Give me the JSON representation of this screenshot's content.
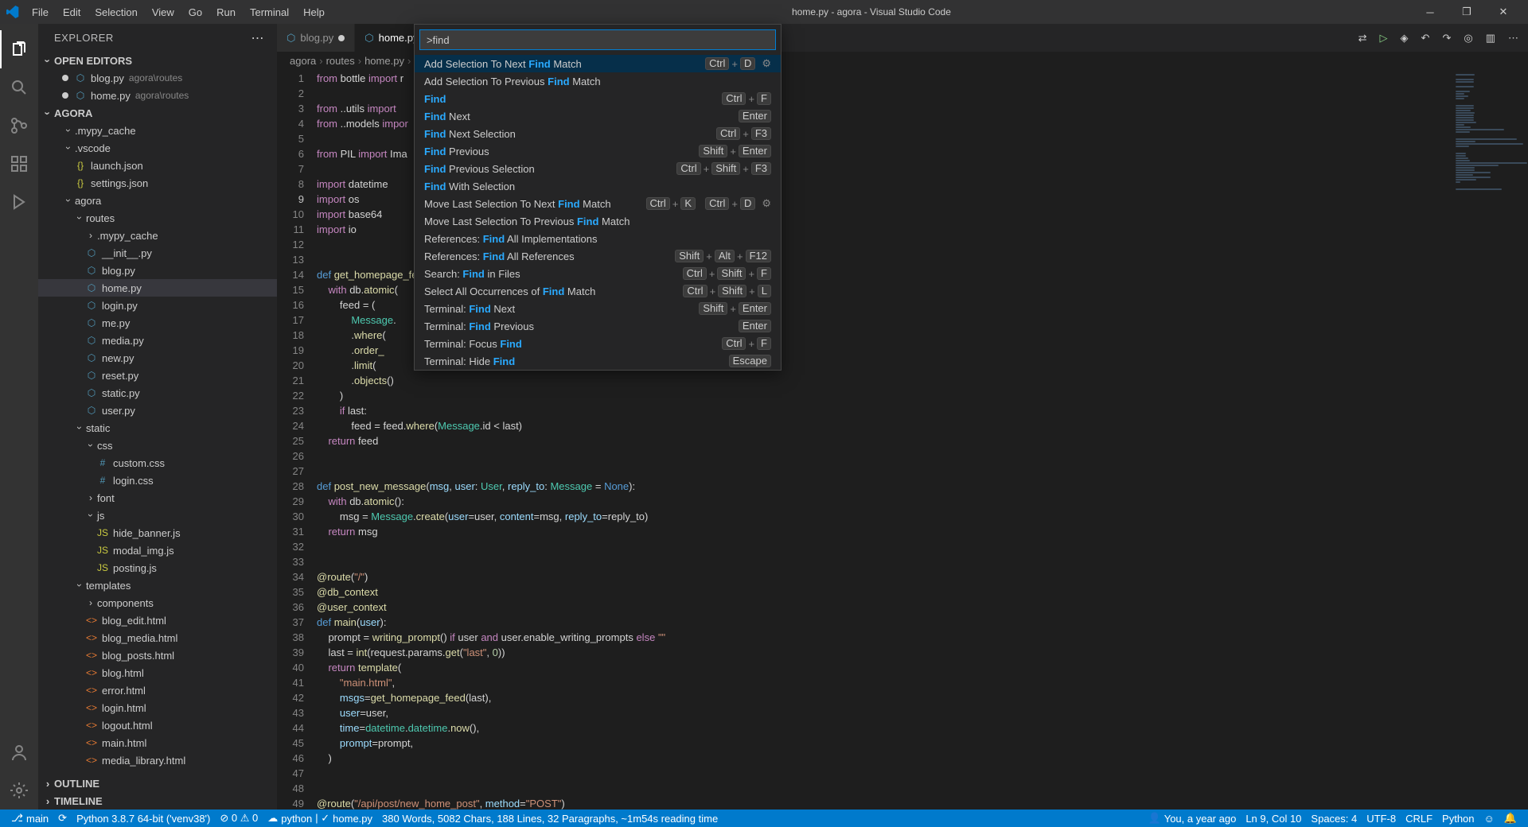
{
  "window_title": "home.py - agora - Visual Studio Code",
  "menu": [
    "File",
    "Edit",
    "Selection",
    "View",
    "Go",
    "Run",
    "Terminal",
    "Help"
  ],
  "explorer_title": "EXPLORER",
  "sections": {
    "open_editors": "OPEN EDITORS",
    "workspace": "AGORA",
    "outline": "OUTLINE",
    "timeline": "TIMELINE"
  },
  "open_editors": [
    {
      "name": "blog.py",
      "desc": "agora\\routes"
    },
    {
      "name": "home.py",
      "desc": "agora\\routes"
    }
  ],
  "tabs": [
    {
      "name": "blog.py",
      "active": false,
      "dirty": true
    },
    {
      "name": "home.py",
      "active": true,
      "dirty": true
    }
  ],
  "breadcrumbs": [
    "agora",
    "routes",
    "home.py",
    "..."
  ],
  "tree": [
    {
      "d": 1,
      "t": "folder",
      "open": true,
      "name": ".mypy_cache"
    },
    {
      "d": 1,
      "t": "folder",
      "open": true,
      "name": ".vscode"
    },
    {
      "d": 2,
      "t": "file",
      "ic": "json",
      "name": "launch.json"
    },
    {
      "d": 2,
      "t": "file",
      "ic": "json",
      "name": "settings.json"
    },
    {
      "d": 1,
      "t": "folder",
      "open": true,
      "name": "agora"
    },
    {
      "d": 2,
      "t": "folder",
      "open": true,
      "name": "routes"
    },
    {
      "d": 3,
      "t": "folder",
      "open": false,
      "name": ".mypy_cache"
    },
    {
      "d": 3,
      "t": "file",
      "ic": "py",
      "name": "__init__.py"
    },
    {
      "d": 3,
      "t": "file",
      "ic": "py",
      "name": "blog.py"
    },
    {
      "d": 3,
      "t": "file",
      "ic": "py",
      "name": "home.py",
      "sel": true
    },
    {
      "d": 3,
      "t": "file",
      "ic": "py",
      "name": "login.py"
    },
    {
      "d": 3,
      "t": "file",
      "ic": "py",
      "name": "me.py"
    },
    {
      "d": 3,
      "t": "file",
      "ic": "py",
      "name": "media.py"
    },
    {
      "d": 3,
      "t": "file",
      "ic": "py",
      "name": "new.py"
    },
    {
      "d": 3,
      "t": "file",
      "ic": "py",
      "name": "reset.py"
    },
    {
      "d": 3,
      "t": "file",
      "ic": "py",
      "name": "static.py"
    },
    {
      "d": 3,
      "t": "file",
      "ic": "py",
      "name": "user.py"
    },
    {
      "d": 2,
      "t": "folder",
      "open": true,
      "name": "static"
    },
    {
      "d": 3,
      "t": "folder",
      "open": true,
      "name": "css"
    },
    {
      "d": 4,
      "t": "file",
      "ic": "css",
      "name": "custom.css"
    },
    {
      "d": 4,
      "t": "file",
      "ic": "css",
      "name": "login.css"
    },
    {
      "d": 3,
      "t": "folder",
      "open": false,
      "name": "font"
    },
    {
      "d": 3,
      "t": "folder",
      "open": true,
      "name": "js"
    },
    {
      "d": 4,
      "t": "file",
      "ic": "js",
      "name": "hide_banner.js"
    },
    {
      "d": 4,
      "t": "file",
      "ic": "js",
      "name": "modal_img.js"
    },
    {
      "d": 4,
      "t": "file",
      "ic": "js",
      "name": "posting.js"
    },
    {
      "d": 2,
      "t": "folder",
      "open": true,
      "name": "templates"
    },
    {
      "d": 3,
      "t": "folder",
      "open": false,
      "name": "components"
    },
    {
      "d": 3,
      "t": "file",
      "ic": "html",
      "name": "blog_edit.html"
    },
    {
      "d": 3,
      "t": "file",
      "ic": "html",
      "name": "blog_media.html"
    },
    {
      "d": 3,
      "t": "file",
      "ic": "html",
      "name": "blog_posts.html"
    },
    {
      "d": 3,
      "t": "file",
      "ic": "html",
      "name": "blog.html"
    },
    {
      "d": 3,
      "t": "file",
      "ic": "html",
      "name": "error.html"
    },
    {
      "d": 3,
      "t": "file",
      "ic": "html",
      "name": "login.html"
    },
    {
      "d": 3,
      "t": "file",
      "ic": "html",
      "name": "logout.html"
    },
    {
      "d": 3,
      "t": "file",
      "ic": "html",
      "name": "main.html"
    },
    {
      "d": 3,
      "t": "file",
      "ic": "html",
      "name": "media_library.html"
    }
  ],
  "palette_input": ">find",
  "palette": [
    {
      "pre": "Add Selection To Next ",
      "hl": "Find",
      "post": " Match",
      "keys": [
        "Ctrl",
        "+",
        "D"
      ],
      "gear": true,
      "sel": true
    },
    {
      "pre": "Add Selection To Previous ",
      "hl": "Find",
      "post": " Match"
    },
    {
      "pre": "",
      "hl": "Find",
      "post": "",
      "keys": [
        "Ctrl",
        "+",
        "F"
      ]
    },
    {
      "pre": "",
      "hl": "Find",
      "post": " Next",
      "keys": [
        "Enter"
      ]
    },
    {
      "pre": "",
      "hl": "Find",
      "post": " Next Selection",
      "keys": [
        "Ctrl",
        "+",
        "F3"
      ]
    },
    {
      "pre": "",
      "hl": "Find",
      "post": " Previous",
      "keys": [
        "Shift",
        "+",
        "Enter"
      ]
    },
    {
      "pre": "",
      "hl": "Find",
      "post": " Previous Selection",
      "keys": [
        "Ctrl",
        "+",
        "Shift",
        "+",
        "F3"
      ]
    },
    {
      "pre": "",
      "hl": "Find",
      "post": " With Selection"
    },
    {
      "pre": "Move Last Selection To Next ",
      "hl": "Find",
      "post": " Match",
      "keys": [
        "Ctrl",
        "+",
        "K",
        "",
        "Ctrl",
        "+",
        "D"
      ],
      "gear": true
    },
    {
      "pre": "Move Last Selection To Previous ",
      "hl": "Find",
      "post": " Match"
    },
    {
      "pre": "References: ",
      "hl": "Find",
      "post": " All Implementations"
    },
    {
      "pre": "References: ",
      "hl": "Find",
      "post": " All References",
      "keys": [
        "Shift",
        "+",
        "Alt",
        "+",
        "F12"
      ]
    },
    {
      "pre": "Search: ",
      "hl": "Find",
      "post": " in Files",
      "keys": [
        "Ctrl",
        "+",
        "Shift",
        "+",
        "F"
      ]
    },
    {
      "pre": "Select All Occurrences of ",
      "hl": "Find",
      "post": " Match",
      "keys": [
        "Ctrl",
        "+",
        "Shift",
        "+",
        "L"
      ]
    },
    {
      "pre": "Terminal: ",
      "hl": "Find",
      "post": " Next",
      "keys": [
        "Shift",
        "+",
        "Enter"
      ]
    },
    {
      "pre": "Terminal: ",
      "hl": "Find",
      "post": " Previous",
      "keys": [
        "Enter"
      ]
    },
    {
      "pre": "Terminal: Focus ",
      "hl": "Find",
      "post": "",
      "keys": [
        "Ctrl",
        "+",
        "F"
      ]
    },
    {
      "pre": "Terminal: Hide ",
      "hl": "Find",
      "post": "",
      "keys": [
        "Escape"
      ]
    }
  ],
  "code": [
    {
      "n": 1,
      "h": "<span class='kw'>from</span> bottle <span class='kw'>import</span> r"
    },
    {
      "n": 2,
      "h": ""
    },
    {
      "n": 3,
      "h": "<span class='kw'>from</span> ..utils <span class='kw'>import</span>"
    },
    {
      "n": 4,
      "h": "<span class='kw'>from</span> ..models <span class='kw'>impor</span>"
    },
    {
      "n": 5,
      "h": ""
    },
    {
      "n": 6,
      "h": "<span class='kw'>from</span> PIL <span class='kw'>import</span> Ima"
    },
    {
      "n": 7,
      "h": ""
    },
    {
      "n": 8,
      "h": "<span class='kw'>import</span> datetime"
    },
    {
      "n": 9,
      "h": "<span class='kw'>import</span> os",
      "cur": true
    },
    {
      "n": 10,
      "h": "<span class='kw'>import</span> base64"
    },
    {
      "n": 11,
      "h": "<span class='kw'>import</span> io"
    },
    {
      "n": 12,
      "h": ""
    },
    {
      "n": 13,
      "h": ""
    },
    {
      "n": 14,
      "h": "<span class='kw2'>def</span> <span class='fn'>get_homepage_fe</span>"
    },
    {
      "n": 15,
      "h": "    <span class='kw'>with</span> db.<span class='fn'>atomic</span>("
    },
    {
      "n": 16,
      "h": "        feed <span class='op'>=</span> ("
    },
    {
      "n": 17,
      "h": "            <span class='cls'>Message</span>."
    },
    {
      "n": 18,
      "h": "            .<span class='fn'>where</span>("
    },
    {
      "n": 19,
      "h": "            .<span class='fn'>order_</span>"
    },
    {
      "n": 20,
      "h": "            .<span class='fn'>limit</span>("
    },
    {
      "n": 21,
      "h": "            .<span class='fn'>objects</span>()"
    },
    {
      "n": 22,
      "h": "        )"
    },
    {
      "n": 23,
      "h": "        <span class='kw'>if</span> last:"
    },
    {
      "n": 24,
      "h": "            feed <span class='op'>=</span> feed.<span class='fn'>where</span>(<span class='cls'>Message</span>.id <span class='op'>&lt;</span> last)"
    },
    {
      "n": 25,
      "h": "    <span class='kw'>return</span> feed"
    },
    {
      "n": 26,
      "h": ""
    },
    {
      "n": 27,
      "h": ""
    },
    {
      "n": 28,
      "h": "<span class='kw2'>def</span> <span class='fn'>post_new_message</span>(<span class='var'>msg</span>, <span class='var'>user</span>: <span class='cls'>User</span>, <span class='var'>reply_to</span>: <span class='cls'>Message</span> <span class='op'>=</span> <span class='kw2'>None</span>):"
    },
    {
      "n": 29,
      "h": "    <span class='kw'>with</span> db.<span class='fn'>atomic</span>():"
    },
    {
      "n": 30,
      "h": "        msg <span class='op'>=</span> <span class='cls'>Message</span>.<span class='fn'>create</span>(<span class='var'>user</span><span class='op'>=</span>user, <span class='var'>content</span><span class='op'>=</span>msg, <span class='var'>reply_to</span><span class='op'>=</span>reply_to)"
    },
    {
      "n": 31,
      "h": "    <span class='kw'>return</span> msg"
    },
    {
      "n": 32,
      "h": ""
    },
    {
      "n": 33,
      "h": ""
    },
    {
      "n": 34,
      "h": "<span class='dec'>@route</span>(<span class='str'>\"/\"</span>)"
    },
    {
      "n": 35,
      "h": "<span class='dec'>@db_context</span>"
    },
    {
      "n": 36,
      "h": "<span class='dec'>@user_context</span>"
    },
    {
      "n": 37,
      "h": "<span class='kw2'>def</span> <span class='fn'>main</span>(<span class='var'>user</span>):"
    },
    {
      "n": 38,
      "h": "    prompt <span class='op'>=</span> <span class='fn'>writing_prompt</span>() <span class='kw'>if</span> user <span class='kw'>and</span> user.enable_writing_prompts <span class='kw'>else</span> <span class='str'>\"\"</span>"
    },
    {
      "n": 39,
      "h": "    last <span class='op'>=</span> <span class='fn'>int</span>(request.params.<span class='fn'>get</span>(<span class='str'>\"last\"</span>, <span class='num'>0</span>))"
    },
    {
      "n": 40,
      "h": "    <span class='kw'>return</span> <span class='fn'>template</span>("
    },
    {
      "n": 41,
      "h": "        <span class='str'>\"main.html\"</span>,"
    },
    {
      "n": 42,
      "h": "        <span class='var'>msgs</span><span class='op'>=</span><span class='fn'>get_homepage_feed</span>(last),"
    },
    {
      "n": 43,
      "h": "        <span class='var'>user</span><span class='op'>=</span>user,"
    },
    {
      "n": 44,
      "h": "        <span class='var'>time</span><span class='op'>=</span><span class='cls'>datetime</span>.<span class='cls'>datetime</span>.<span class='fn'>now</span>(),"
    },
    {
      "n": 45,
      "h": "        <span class='var'>prompt</span><span class='op'>=</span>prompt,"
    },
    {
      "n": 46,
      "h": "    )"
    },
    {
      "n": 47,
      "h": ""
    },
    {
      "n": 48,
      "h": ""
    },
    {
      "n": 49,
      "h": "<span class='dec'>@route</span>(<span class='str'>\"/api/post/new_home_post\"</span>, <span class='var'>method</span><span class='op'>=</span><span class='str'>\"POST\"</span>)"
    }
  ],
  "status": {
    "branch": "main",
    "python": "Python 3.8.7 64-bit ('venv38')",
    "problems": "0 ⚠ 0",
    "lang_server": "python",
    "file": "home.py",
    "stats": "380 Words, 5082 Chars, 188 Lines, 32 Paragraphs, ~1m54s reading time",
    "blame": "You, a year ago",
    "cursor": "Ln 9, Col 10",
    "spaces": "Spaces: 4",
    "encoding": "UTF-8",
    "eol": "CRLF",
    "lang": "Python"
  }
}
